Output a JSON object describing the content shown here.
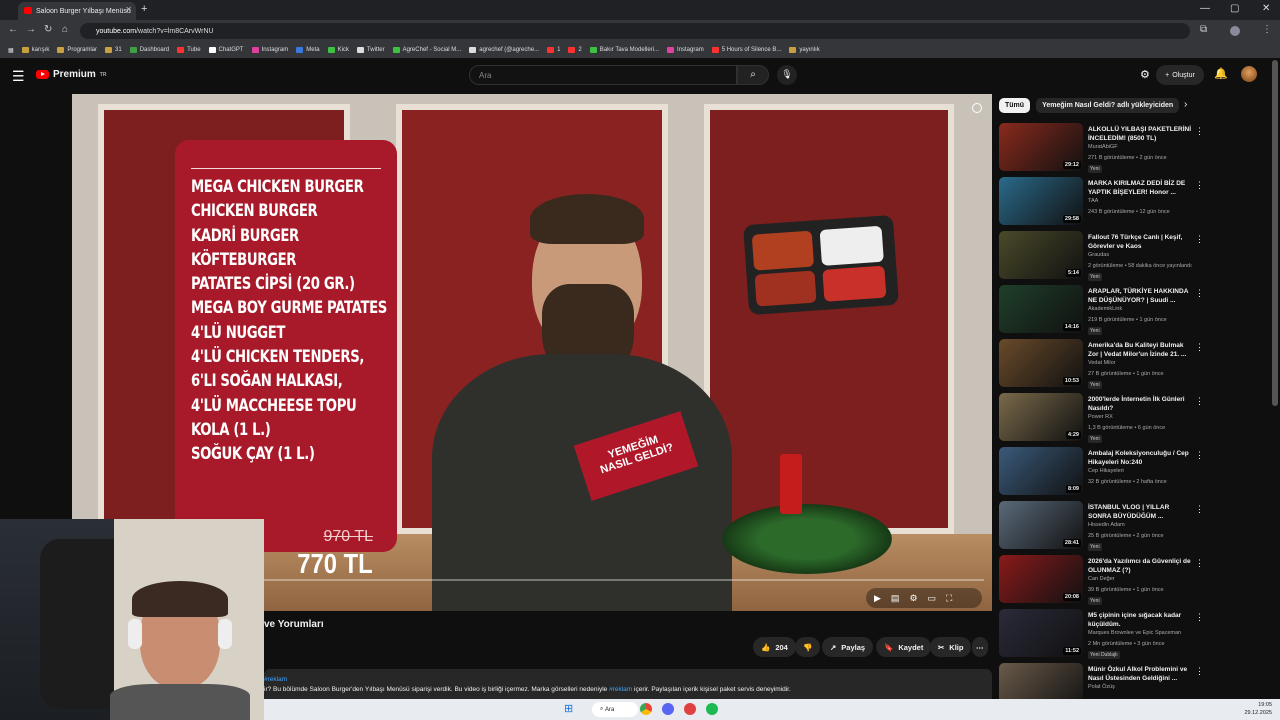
{
  "browser": {
    "tab_title": "Saloon Burger Yılbaşı Menüsü",
    "url_host": "youtube.com",
    "url_path": "/watch?v=lm8CArvWrNU",
    "bookmarks": [
      "karışık",
      "Programlar",
      "31",
      "Dashboard",
      "Tube",
      "ChatGPT",
      "Instagram",
      "Meta",
      "Kick",
      "Twitter",
      "AgreChef - Social M...",
      "agrechef (@agreche...",
      "1",
      "2",
      "Bakır Tava Modelleri...",
      "Instagram",
      "5 Hours of Silence B...",
      "yayınlık"
    ]
  },
  "youtube": {
    "logo": "Premium",
    "logo_sup": "TR",
    "search_placeholder": "Ara",
    "create_label": "Oluştur"
  },
  "video": {
    "menu_items": [
      "MEGA CHICKEN BURGER",
      "CHICKEN BURGER",
      "KADRİ BURGER",
      "KÖFTEBURGER",
      "PATATES CİPSİ (20 GR.)",
      "MEGA BOY GURME PATATES",
      "4'LÜ NUGGET",
      "4'LÜ CHICKEN TENDERS,",
      "6'LI SOĞAN HALKASI,",
      "4'LÜ MACCHEESE TOPU",
      "KOLA (1 L.)",
      "SOĞUK ÇAY (1 L.)"
    ],
    "old_price": "970 TL",
    "new_price": "770 TL",
    "book_text_1": "YEMEĞİM",
    "book_text_2": "NASIL GELDİ?",
    "title_fragment": "ve Yorumları",
    "likes": "204",
    "share_label": "Paylaş",
    "save_label": "Kaydet",
    "clip_label": "Klip",
    "desc_tag": "#reklam",
    "desc_text_1": "ir? Bu bölümde Saloon Burger'den Yılbaşı Menüsü siparişi verdik. Bu video iş birliği içermez. Marka görselleri nedeniyle ",
    "desc_text_2": " içerir. Paylaşılan içerik kişisel paket servis deneyimidir."
  },
  "chips": [
    "Tümü",
    "Yemeğim Nasıl Geldi? adlı yükleyiciden"
  ],
  "recommendations": [
    {
      "title": "ALKOLLÜ YILBAŞI PAKETLERİNİ İNCELEDİM! (8500 TL)",
      "channel": "MuratAbiGF",
      "meta": "271 B görüntüleme • 2 gün önce",
      "badge": "Yeni",
      "duration": "29:12",
      "color": "#8a2a1c"
    },
    {
      "title": "MARKA KIRILMAZ DEDİ BİZ DE YAPTIK BİŞEYLER! Honor ...",
      "channel": "TAA",
      "meta": "243 B görüntüleme • 12 gün önce",
      "badge": "",
      "duration": "29:58",
      "color": "#2a6a8a"
    },
    {
      "title": "Fallout 76 Türkçe Canlı | Keşif, Görevler ve Kaos",
      "channel": "Graudas",
      "meta": "2 görüntüleme • 58 dakika önce yayınlandı",
      "badge": "Yeni",
      "duration": "5:14",
      "color": "#4a4a2a"
    },
    {
      "title": "ARAPLAR, TÜRKİYE HAKKINDA NE DÜŞÜNÜYOR? | Suudi ...",
      "channel": "AkademikLink",
      "meta": "219 B görüntüleme • 1 gün önce",
      "badge": "Yeni",
      "duration": "14:16",
      "color": "#1f3f2a"
    },
    {
      "title": "Amerika'da Bu Kaliteyi Bulmak Zor | Vedat Milor'un İzinde 21. ...",
      "channel": "Vedat Milor",
      "meta": "27 B görüntüleme • 1 gün önce",
      "badge": "Yeni",
      "duration": "10:53",
      "color": "#6a4a2a"
    },
    {
      "title": "2000'lerde İnternetin İlk Günleri Nasıldı?",
      "channel": "Power RX",
      "meta": "1,3 B görüntüleme • 6 gün önce",
      "badge": "Yeni",
      "duration": "4:29",
      "color": "#7a6a4a"
    },
    {
      "title": "Ambalaj Koleksiyonculuğu / Cep Hikayeleri No:240",
      "channel": "Cep Hikayeleri",
      "meta": "32 B görüntüleme • 2 hafta önce",
      "badge": "",
      "duration": "8:09",
      "color": "#3a5a7a"
    },
    {
      "title": "İSTANBUL VLOG | YILLAR SONRA BÜYÜDÜĞÜM ...",
      "channel": "Hissedin Adam",
      "meta": "25 B görüntüleme • 2 gün önce",
      "badge": "Yeni",
      "duration": "28:41",
      "color": "#5a6a7a"
    },
    {
      "title": "2026'da Yazılımcı da Güvenliçi de OLUNMAZ (?)",
      "channel": "Can Değer",
      "meta": "39 B görüntüleme • 1 gün önce",
      "badge": "Yeni",
      "duration": "20:08",
      "color": "#8a1a1a"
    },
    {
      "title": "M5 çipinin içine sığacak kadar küçüldüm.",
      "channel": "Marques Brownlee ve Epic Spaceman",
      "meta": "2 Mn görüntüleme • 3 gün önce",
      "badge": "Yeni  Dublajlı",
      "duration": "11:52",
      "color": "#2a2a3a"
    },
    {
      "title": "Münir Özkul Alkol Problemini ve Nasıl Üstesinden Geldiğini ...",
      "channel": "Polat Özüş",
      "meta": "",
      "badge": "",
      "duration": "",
      "color": "#6a5a4a"
    }
  ],
  "taskbar": {
    "search": "Ara",
    "time": "19:05",
    "date": "29.12.2025"
  }
}
